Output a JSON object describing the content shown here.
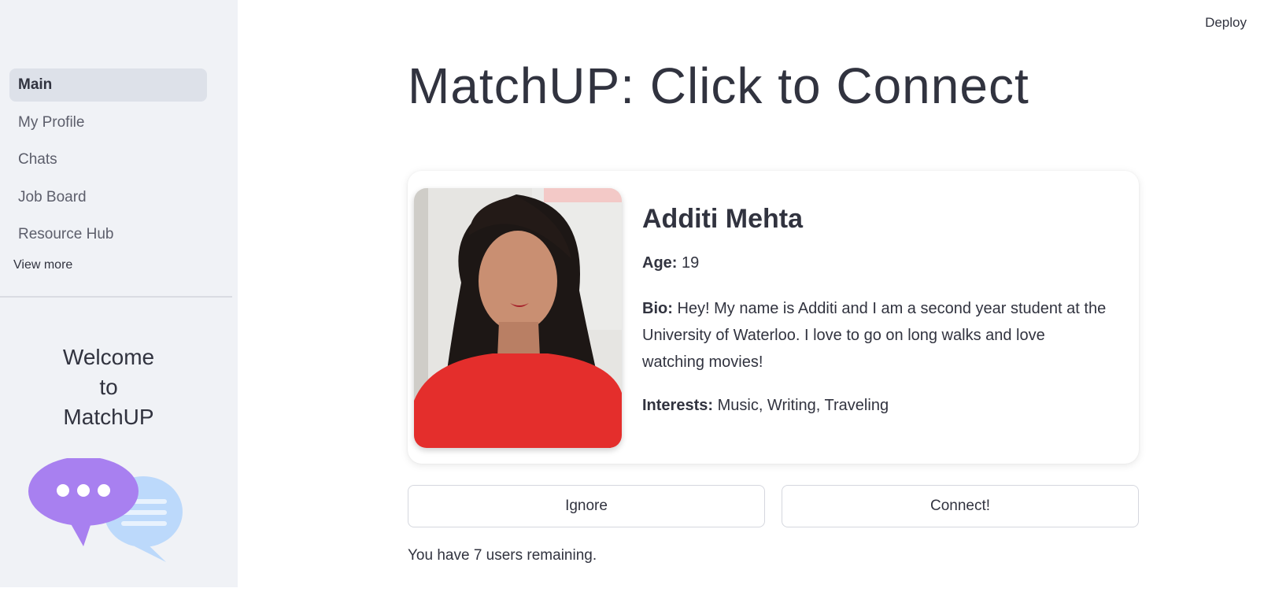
{
  "header": {
    "deploy_label": "Deploy"
  },
  "sidebar": {
    "items": [
      {
        "label": "Main",
        "active": true
      },
      {
        "label": "My Profile",
        "active": false
      },
      {
        "label": "Chats",
        "active": false
      },
      {
        "label": "Job Board",
        "active": false
      },
      {
        "label": "Resource Hub",
        "active": false
      }
    ],
    "view_more_label": "View more",
    "welcome_lines": [
      "Welcome",
      "to",
      "MatchUP"
    ],
    "illustration_colors": {
      "primary_bubble": "#a880f0",
      "secondary_bubble": "#bcd9fb"
    }
  },
  "main": {
    "title": "MatchUP: Click to Connect",
    "profile": {
      "name": "Additi Mehta",
      "age_label": "Age:",
      "age_value": "19",
      "bio_label": "Bio:",
      "bio_value": "Hey! My name is Additi and I am a second year student at the University of Waterloo. I love to go on long walks and love watching movies!",
      "interests_label": "Interests:",
      "interests_value": "Music, Writing, Traveling"
    },
    "ignore_label": "Ignore",
    "connect_label": "Connect!",
    "remaining_text": "You have 7 users remaining."
  }
}
